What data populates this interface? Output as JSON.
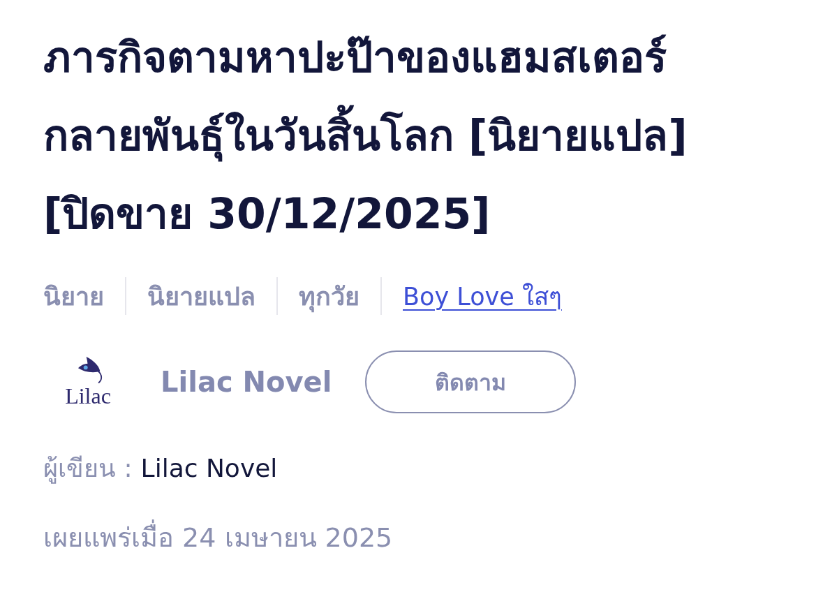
{
  "title": "ภารกิจตามหาปะป๊าของแฮมสเตอร์กลายพันธุ์ในวันสิ้นโลก [นิยายแปล] [ปิดขาย 30/12/2025]",
  "tags": [
    {
      "label": "นิยาย",
      "kind": "category"
    },
    {
      "label": "นิยายแปล",
      "kind": "category"
    },
    {
      "label": "ทุกวัย",
      "kind": "category"
    },
    {
      "label": "Boy Love ใสๆ",
      "kind": "link"
    }
  ],
  "publisher": {
    "logo_text": "Lilac",
    "name": "Lilac Novel",
    "follow_button": "ติดตาม"
  },
  "author": {
    "label": "ผู้เขียน :",
    "name": "Lilac Novel"
  },
  "published": "เผยแพร่เมื่อ 24 เมษายน 2025"
}
